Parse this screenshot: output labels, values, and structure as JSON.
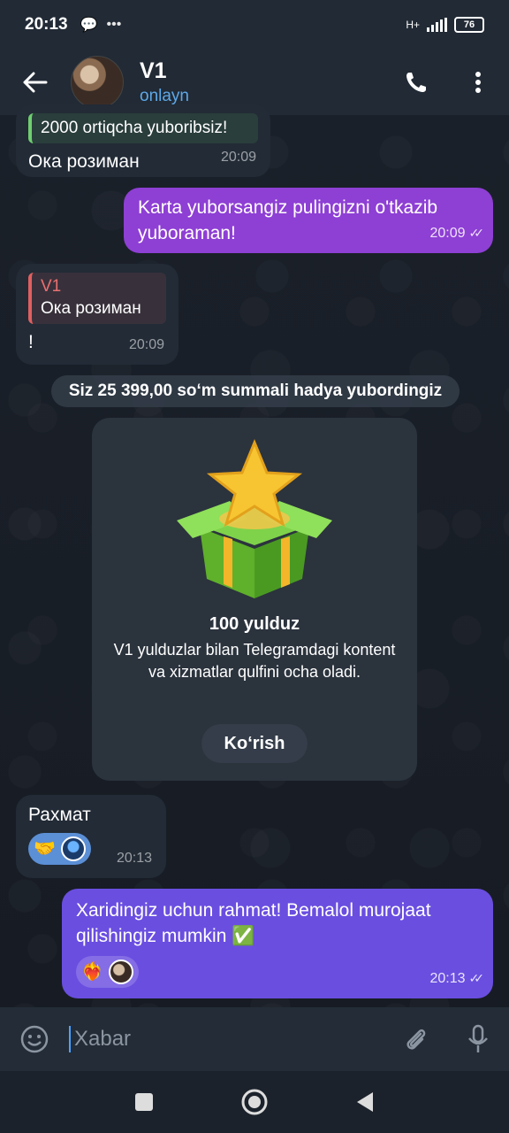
{
  "status_bar": {
    "time": "20:13",
    "icons": [
      "chat-bubble-icon",
      "more-dots-icon"
    ],
    "network": "H+",
    "battery": "76"
  },
  "header": {
    "title": "V1",
    "status": "onlayn"
  },
  "messages": [
    {
      "dir": "in",
      "quote_text": "2000 ortiqcha yuboribsiz!",
      "text": "Ока розиман",
      "time": "20:09"
    },
    {
      "dir": "out",
      "text": "Karta yuborsangiz pulingizni o'tkazib yuboraman!",
      "time": "20:09"
    },
    {
      "dir": "in",
      "quote_name": "V1",
      "quote_text": "Ока розиман",
      "text": "!",
      "time": "20:09"
    },
    {
      "dir": "in",
      "text": "Рахмат",
      "time": "20:13",
      "reaction": "🤝"
    },
    {
      "dir": "out",
      "text": "Xaridingiz uchun rahmat! Bemalol murojaat qilishingiz mumkin ✅",
      "time": "20:13",
      "reaction": "❤️‍🔥"
    }
  ],
  "service": {
    "text": "Siz 25 399,00 so‘m summali hadya yubordingiz"
  },
  "gift": {
    "title": "100 yulduz",
    "description": "V1 yulduzlar bilan Telegramdagi kontent va xizmatlar qulfini ocha oladi.",
    "button": "Ko‘rish"
  },
  "input": {
    "placeholder": "Xabar"
  },
  "colors": {
    "outgoing_bubble": "#8e3fd4",
    "outgoing_bubble_2": "#6a4ee0",
    "incoming_bubble": "#222b36",
    "accent": "#5ea8e8"
  }
}
